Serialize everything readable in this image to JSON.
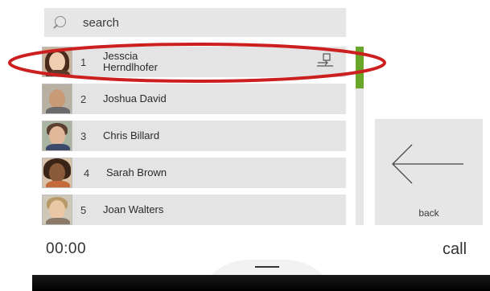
{
  "search": {
    "placeholder": "search",
    "icon": "search-icon"
  },
  "contacts": [
    {
      "num": "1",
      "name_line1": "Jesscia",
      "name_line2": "Herndlhofer",
      "has_voicemail": true
    },
    {
      "num": "2",
      "name": "Joshua David"
    },
    {
      "num": "3",
      "name": "Chris Billard"
    },
    {
      "num": "4",
      "name": "Sarah Brown"
    },
    {
      "num": "5",
      "name": "Joan Walters"
    }
  ],
  "scrollbar": {
    "color": "#6aa62a",
    "position": 0
  },
  "back_button": {
    "label": "back",
    "icon": "arrow-left-icon"
  },
  "footer": {
    "timer": "00:00",
    "call_label": "call"
  },
  "annotation": {
    "color": "#cc1f1f"
  }
}
